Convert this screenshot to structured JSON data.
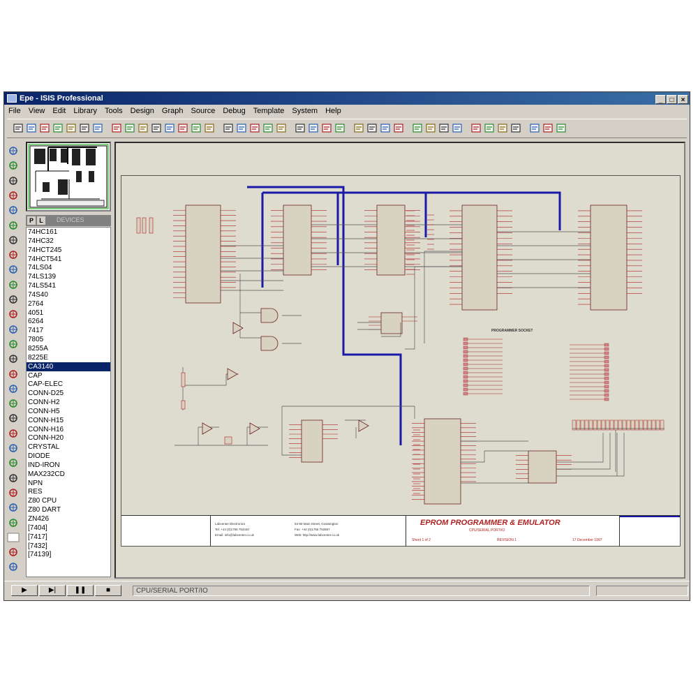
{
  "window": {
    "title": "Epe - ISIS Professional",
    "controls": [
      "_",
      "□",
      "×"
    ]
  },
  "menu": [
    "File",
    "View",
    "Edit",
    "Library",
    "Tools",
    "Design",
    "Graph",
    "Source",
    "Debug",
    "Template",
    "System",
    "Help"
  ],
  "toolbar": {
    "icons": [
      "new-icon",
      "open-icon",
      "save-icon",
      "import-icon",
      "export-icon",
      "print-icon",
      "print-area-icon",
      "refresh-icon",
      "grid-icon",
      "origin-icon",
      "pan-icon",
      "zoom-in-icon",
      "zoom-out-icon",
      "zoom-all-icon",
      "zoom-area-icon",
      "undo-icon",
      "redo-icon",
      "cut-icon",
      "copy-icon",
      "paste-icon",
      "block-copy-icon",
      "block-move-icon",
      "block-rotate-icon",
      "block-delete-icon",
      "pick-device-icon",
      "make-device-icon",
      "packaging-icon",
      "decompose-icon",
      "wire-autorouter-icon",
      "search-tag-icon",
      "property-assign-icon",
      "netlist-icon",
      "new-sheet-icon",
      "remove-sheet-icon",
      "goto-sheet-icon",
      "exit-to-parent-icon",
      "bill-of-materials-icon",
      "erc-icon",
      "netlist-ares-icon"
    ]
  },
  "left_tools": [
    "select-icon",
    "component-icon",
    "junction-dot-icon",
    "wire-label-icon",
    "script-icon",
    "bus-icon",
    "subcircuit-icon",
    "instant-edit-icon",
    "terminal-icon",
    "device-pin-icon",
    "graph-icon",
    "tape-recorder-icon",
    "generator-icon",
    "voltage-probe-icon",
    "current-probe-icon",
    "virtual-instrument-icon",
    "line-icon",
    "box-icon",
    "circle-icon",
    "arc-icon",
    "path-icon",
    "text-icon",
    "symbol-icon",
    "marker-icon",
    "rotate-cw-icon",
    "rotate-ccw-icon",
    "angle-field",
    "mirror-x-icon",
    "mirror-y-icon"
  ],
  "picker": {
    "buttons": [
      "P",
      "L"
    ],
    "title": "DEVICES",
    "selected_index": 15,
    "devices": [
      "74HC161",
      "74HC32",
      "74HCT245",
      "74HCT541",
      "74LS04",
      "74LS139",
      "74LS541",
      "74S40",
      "2764",
      "4051",
      "6264",
      "7417",
      "7805",
      "8255A",
      "8225E",
      "CA3140",
      "CAP",
      "CAP-ELEC",
      "CONN-D25",
      "CONN-H2",
      "CONN-H5",
      "CONN-H15",
      "CONN-H16",
      "CONN-H20",
      "CRYSTAL",
      "DIODE",
      "IND-IRON",
      "MAX232CD",
      "NPN",
      "RES",
      "Z80 CPU",
      "Z80 DART",
      "ZN426",
      "[7404]",
      "[7417]",
      "[7432]",
      "[74139]"
    ]
  },
  "schematic": {
    "socket_label": "PROGRAMMER SOCKET",
    "title_block": {
      "company_lines": [
        "Labcenter Electronics",
        "Tel: +44 (0)1756 753440",
        "Email: info@labcenter.co.uk"
      ],
      "address_lines": [
        "53-55 Main Street, Grassington",
        "Fax: +44 (0)1756 752857",
        "Web: http://www.labcenter.co.uk"
      ],
      "project_title": "EPROM PROGRAMMER & EMULATOR",
      "subtitle": "CPU/SERIAL PORT/IO",
      "sheet": "Sheet 1 of 2",
      "revision": "REVISION 1",
      "date": "17 December 1997"
    }
  },
  "status": {
    "controls": [
      "▶",
      "▶|",
      "❚❚",
      "■"
    ],
    "message": "CPU/SERIAL PORT/IO"
  },
  "colors": {
    "titlebar": "#0a246a",
    "bus": "#1a1aa6",
    "wire": "#555555",
    "pin": "#b02020",
    "paper": "#dedbcf"
  }
}
